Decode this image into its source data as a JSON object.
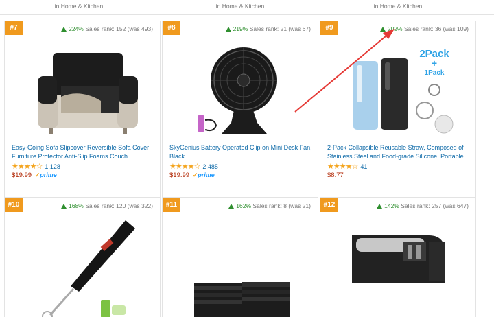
{
  "top_categories": [
    "in Home & Kitchen",
    "in Home & Kitchen",
    "in Home & Kitchen"
  ],
  "colors": {
    "badge": "#f09a1e",
    "link": "#0e6aa8",
    "price": "#b12704",
    "up_arrow": "#2f8f2f",
    "stars": "#f4a41d",
    "annotation": "#e53935"
  },
  "products": [
    {
      "rank": "#7",
      "pct": "224%",
      "sales_rank": "Sales rank: 152 (was 493)",
      "title": "Easy-Going Sofa Slipcover Reversible Sofa Cover Furniture Protector Anti-Slip Foams Couch...",
      "rating_count": "1,128",
      "stars": 4.5,
      "price": "$19.99",
      "prime": "prime",
      "image": "sofa-slipcover"
    },
    {
      "rank": "#8",
      "pct": "219%",
      "sales_rank": "Sales rank: 21 (was 67)",
      "title": "SkyGenius Battery Operated Clip on Mini Desk Fan, Black",
      "rating_count": "2,485",
      "stars": 4.5,
      "price": "$19.99",
      "prime": "prime",
      "image": "clip-fan"
    },
    {
      "rank": "#9",
      "pct": "202%",
      "sales_rank": "Sales rank: 36 (was 109)",
      "title": "2-Pack Collapsible Reusable Straw, Composed of Stainless Steel and Food-grade Silicone, Portable...",
      "rating_count": "41",
      "stars": 4.5,
      "price": "$8.77",
      "prime": "",
      "image": "collapsible-straw",
      "image_text": [
        "2Pack",
        "+",
        "1Pack"
      ]
    },
    {
      "rank": "#10",
      "pct": "168%",
      "sales_rank": "Sales rank: 120 (was 322)",
      "image": "milk-frother"
    },
    {
      "rank": "#11",
      "pct": "162%",
      "sales_rank": "Sales rank: 8 (was 21)",
      "image": "black-towels"
    },
    {
      "rank": "#12",
      "pct": "142%",
      "sales_rank": "Sales rank: 257 (was 647)",
      "image": "knife-sharpener"
    }
  ]
}
